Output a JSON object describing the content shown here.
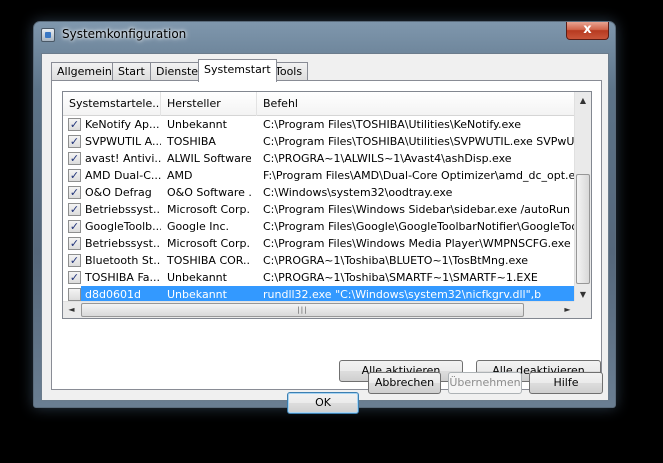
{
  "window": {
    "title": "Systemkonfiguration",
    "close_label": "x"
  },
  "tabs": [
    {
      "label": "Allgemein",
      "active": false
    },
    {
      "label": "Start",
      "active": false
    },
    {
      "label": "Dienste",
      "active": false
    },
    {
      "label": "Systemstart",
      "active": true
    },
    {
      "label": "Tools",
      "active": false
    }
  ],
  "table": {
    "columns": [
      "Systemstartele...",
      "Hersteller",
      "Befehl"
    ],
    "rows": [
      {
        "checked": true,
        "name": "KeNotify Ap...",
        "vendor": "Unbekannt",
        "command": "C:\\Program Files\\TOSHIBA\\Utilities\\KeNotify.exe"
      },
      {
        "checked": true,
        "name": "SVPWUTIL A...",
        "vendor": "TOSHIBA",
        "command": "C:\\Program Files\\TOSHIBA\\Utilities\\SVPWUTIL.exe SVPwUTIL"
      },
      {
        "checked": true,
        "name": "avast! Antivi...",
        "vendor": "ALWIL Software",
        "command": "C:\\PROGRA~1\\ALWILS~1\\Avast4\\ashDisp.exe"
      },
      {
        "checked": true,
        "name": "AMD Dual-C...",
        "vendor": "AMD",
        "command": "F:\\Program Files\\AMD\\Dual-Core Optimizer\\amd_dc_opt.exe"
      },
      {
        "checked": true,
        "name": "O&O Defrag",
        "vendor": "O&O Software ...",
        "command": "C:\\Windows\\system32\\oodtray.exe"
      },
      {
        "checked": true,
        "name": "Betriebssyst...",
        "vendor": "Microsoft Corp...",
        "command": "C:\\Program Files\\Windows Sidebar\\sidebar.exe /autoRun"
      },
      {
        "checked": true,
        "name": "GoogleToolb...",
        "vendor": "Google Inc.",
        "command": "C:\\Program Files\\Google\\GoogleToolbarNotifier\\GoogleToolbarNot"
      },
      {
        "checked": true,
        "name": "Betriebssyst...",
        "vendor": "Microsoft Corp...",
        "command": "C:\\Program Files\\Windows Media Player\\WMPNSCFG.exe"
      },
      {
        "checked": true,
        "name": "Bluetooth St...",
        "vendor": "TOSHIBA COR...",
        "command": "C:\\PROGRA~1\\Toshiba\\BLUETO~1\\TosBtMng.exe"
      },
      {
        "checked": true,
        "name": "TOSHIBA Fa...",
        "vendor": "Unbekannt",
        "command": "C:\\PROGRA~1\\Toshiba\\SMARTF~1\\SMARTF~1.EXE"
      },
      {
        "checked": false,
        "name": "d8d0601d",
        "vendor": "Unbekannt",
        "command": "rundll32.exe \"C:\\Windows\\system32\\nicfkgrv.dll\",b",
        "selected": true
      }
    ]
  },
  "buttons": {
    "enable_all": "Alle aktivieren",
    "disable_all": "Alle deaktivieren",
    "ok": "OK",
    "cancel": "Abbrechen",
    "apply": "Übernehmen",
    "help": "Hilfe"
  },
  "icons": {
    "app": "system-config-icon",
    "scroll_up": "▲",
    "scroll_down": "▼",
    "scroll_left": "◄",
    "scroll_right": "►",
    "thumb_grip": "|||",
    "check": "✓"
  },
  "colors": {
    "selection": "#3399ff",
    "close_button": "#c9553a"
  }
}
